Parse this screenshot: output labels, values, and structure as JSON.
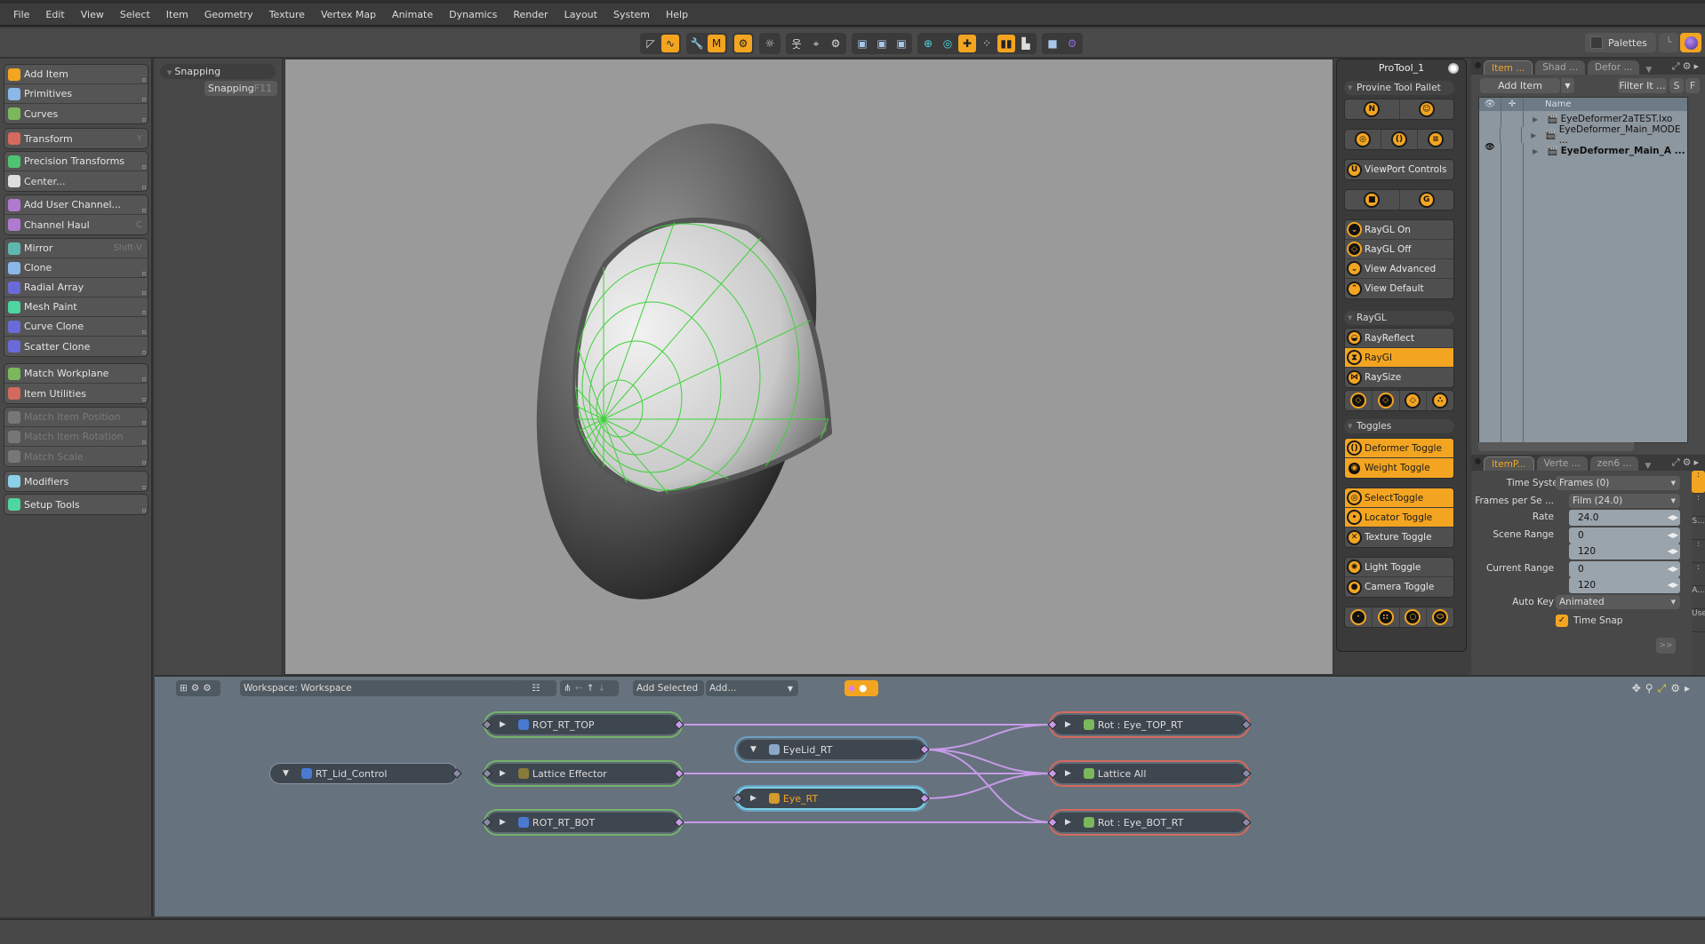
{
  "menu": [
    "File",
    "Edit",
    "View",
    "Select",
    "Item",
    "Geometry",
    "Texture",
    "Vertex Map",
    "Animate",
    "Dynamics",
    "Render",
    "Layout",
    "System",
    "Help"
  ],
  "toolbar": {
    "groups": [
      {
        "icons": [
          "curve-tool-icon",
          "falloff-path-icon"
        ],
        "active": [
          1
        ]
      },
      {
        "icons": [
          "wrench-icon",
          "m-modifier-icon"
        ],
        "active": [
          1
        ]
      },
      {
        "icons": [
          "gear-wrench-icon"
        ],
        "active": [
          0
        ]
      },
      {
        "icons": [
          "sun-gear-icon"
        ],
        "active": []
      },
      {
        "icons": [
          "figure-icon",
          "crosshair-icon",
          "tool-gear-icon"
        ],
        "active": []
      },
      {
        "icons": [
          "cube-vertex-icon",
          "cube-edge-icon",
          "cube-poly-icon"
        ],
        "active": []
      },
      {
        "icons": [
          "target-icon",
          "ring-icon",
          "center-target-icon",
          "dots-circle-icon",
          "split-panel-icon",
          "grid-corner-icon"
        ],
        "active": [
          2,
          4
        ]
      },
      {
        "icons": [
          "purple-cube-icon",
          "purple-gear-icon"
        ],
        "active": []
      }
    ],
    "palettes_label": "Palettes"
  },
  "left_panel": {
    "groups": [
      {
        "items": [
          {
            "label": "Add Item",
            "icon": "add-icon"
          },
          {
            "label": "Primitives",
            "icon": "cube-icon"
          },
          {
            "label": "Curves",
            "icon": "curve-c-icon"
          }
        ]
      },
      {
        "items": [
          {
            "label": "Transform",
            "icon": "transform-icon",
            "shortcut": "Y"
          }
        ]
      },
      {
        "items": [
          {
            "label": "Precision Transforms",
            "icon": "precision-icon"
          },
          {
            "label": "Center...",
            "icon": "center-icon"
          }
        ]
      },
      {
        "items": [
          {
            "label": "Add User Channel...",
            "icon": "user-channel-icon"
          },
          {
            "label": "Channel Haul",
            "icon": "channel-haul-icon",
            "shortcut": "C"
          }
        ]
      },
      {
        "items": [
          {
            "label": "Mirror",
            "icon": "mirror-icon",
            "shortcut": "Shift-V"
          },
          {
            "label": "Clone",
            "icon": "clone-icon"
          },
          {
            "label": "Radial Array",
            "icon": "radial-array-icon"
          },
          {
            "label": "Mesh Paint",
            "icon": "mesh-paint-icon"
          },
          {
            "label": "Curve Clone",
            "icon": "curve-clone-icon"
          },
          {
            "label": "Scatter Clone",
            "icon": "scatter-clone-icon"
          }
        ]
      },
      {
        "items": [
          {
            "label": "Match Workplane",
            "icon": "workplane-icon"
          },
          {
            "label": "Item Utilities",
            "icon": "item-utilities-icon"
          }
        ]
      },
      {
        "items": [
          {
            "label": "Match Item Position",
            "icon": "match-position-icon",
            "disabled": true
          },
          {
            "label": "Match Item Rotation",
            "icon": "match-rotation-icon",
            "disabled": true
          },
          {
            "label": "Match Scale",
            "icon": "match-scale-icon",
            "disabled": true
          }
        ]
      },
      {
        "items": [
          {
            "label": "Modifiers",
            "icon": "modifiers-icon"
          }
        ]
      },
      {
        "items": [
          {
            "label": "Setup Tools",
            "icon": "setup-gear-icon"
          }
        ]
      }
    ]
  },
  "snapping": {
    "header": "Snapping",
    "button": "Snapping",
    "shortcut": "F11"
  },
  "protool": {
    "title": "ProTool_1",
    "section1": "Provine  Tool  Pallet",
    "viewport_controls": "ViewPort Controls",
    "view_items": [
      {
        "label": "RayGL On",
        "active": false
      },
      {
        "label": "RayGL Off",
        "active": false
      },
      {
        "label": "View Advanced",
        "active": false
      },
      {
        "label": "View Default",
        "active": false
      }
    ],
    "raygl_section": "RayGL",
    "raygl_items": [
      {
        "label": "RayReflect",
        "active": false
      },
      {
        "label": "RayGI",
        "active": true
      },
      {
        "label": "RaySize",
        "active": false
      }
    ],
    "toggles_section": "Toggles",
    "toggles_a": [
      {
        "label": "Deformer Toggle",
        "active": true
      },
      {
        "label": "Weight Toggle",
        "active": true
      }
    ],
    "toggles_b": [
      {
        "label": "SelectToggle",
        "active": true
      },
      {
        "label": "Locator Toggle",
        "active": true
      },
      {
        "label": "Texture Toggle",
        "active": false
      }
    ],
    "toggles_c": [
      {
        "label": "Light Toggle",
        "active": false
      },
      {
        "label": "Camera Toggle",
        "active": false
      }
    ]
  },
  "right_panel": {
    "top_tabs": [
      {
        "label": "Item ...",
        "active": true
      },
      {
        "label": "Shad ...",
        "active": false
      },
      {
        "label": "Defor ...",
        "active": false
      }
    ],
    "add_item": "Add Item",
    "filter": "Filter It ...",
    "s_btn": "S",
    "f_btn": "F",
    "tree_header": "Name",
    "tree_rows": [
      {
        "name": "EyeDeformer2aTEST.lxo",
        "visible": false,
        "bold": false
      },
      {
        "name": "EyeDeformer_Main_MODE ...",
        "visible": false,
        "bold": false
      },
      {
        "name": "EyeDeformer_Main_A ...",
        "visible": true,
        "bold": true
      }
    ],
    "bottom_tabs": [
      {
        "label": "ItemP...",
        "active": true
      },
      {
        "label": "Verte ...",
        "active": false
      },
      {
        "label": "zen6 ...",
        "active": false
      }
    ],
    "properties": {
      "time_system_label": "Time System",
      "time_system_value": "Frames (0)",
      "fps_label": "Frames per Se ...",
      "fps_value": "Film (24.0)",
      "rate_label": "Rate",
      "rate_value": "24.0",
      "scene_range_label": "Scene Range",
      "scene_range": [
        "0",
        "120"
      ],
      "current_range_label": "Current Range",
      "current_range": [
        "0",
        "120"
      ],
      "auto_key_label": "Auto Key",
      "auto_key_value": "Animated",
      "time_snap_label": "Time Snap",
      "time_snap_checked": true,
      "more_btn": ">>"
    },
    "side_tabs": [
      ":",
      ":",
      "S...",
      ":",
      ":",
      "A...",
      "User..."
    ]
  },
  "node_editor": {
    "workspace": "Workspace: Workspace",
    "add_selected": "Add Selected",
    "add": "Add...",
    "nodes": [
      {
        "id": "rt_lid_control",
        "label": "RT_Lid_Control",
        "style": "plain",
        "expanded": true
      },
      {
        "id": "rot_rt_top",
        "label": "ROT_RT_TOP",
        "style": "green",
        "expanded": false
      },
      {
        "id": "lattice_effector",
        "label": "Lattice Effector",
        "style": "green",
        "expanded": false
      },
      {
        "id": "rot_rt_bot",
        "label": "ROT_RT_BOT",
        "style": "green",
        "expanded": false
      },
      {
        "id": "eyelid_rt",
        "label": "EyeLid_RT",
        "style": "blue",
        "expanded": true
      },
      {
        "id": "eye_rt",
        "label": "Eye_RT",
        "style": "blue2",
        "expanded": false
      },
      {
        "id": "rot_eye_top_rt",
        "label": "Rot : Eye_TOP_RT",
        "style": "red",
        "expanded": false
      },
      {
        "id": "lattice_all",
        "label": "Lattice All",
        "style": "red",
        "expanded": false
      },
      {
        "id": "rot_eye_bot_rt",
        "label": "Rot : Eye_BOT_RT",
        "style": "red",
        "expanded": false
      }
    ],
    "links": [
      [
        "rot_rt_top",
        "rot_eye_top_rt"
      ],
      [
        "lattice_effector",
        "lattice_all"
      ],
      [
        "rot_rt_bot",
        "rot_eye_bot_rt"
      ],
      [
        "eyelid_rt",
        "rot_eye_top_rt"
      ],
      [
        "eyelid_rt",
        "lattice_all"
      ],
      [
        "eyelid_rt",
        "rot_eye_bot_rt"
      ],
      [
        "eye_rt",
        "lattice_all"
      ]
    ]
  },
  "colors": {
    "accent": "#f3a521",
    "link": "#c69be8",
    "node_green": "#74b36a",
    "node_blue": "#6ba1c2",
    "node_red": "#d46a5d",
    "wire": "#3fd13a"
  }
}
